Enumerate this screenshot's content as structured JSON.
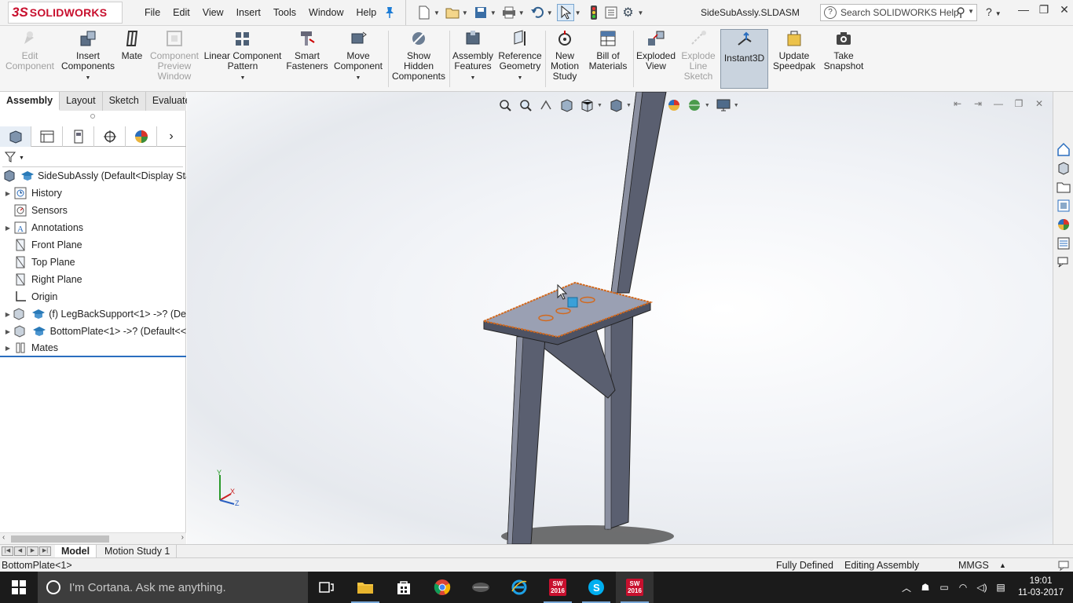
{
  "app": {
    "logo_mark": "3S",
    "logo_text": "SOLIDWORKS",
    "document_title": "SideSubAssly.SLDASM"
  },
  "menu": [
    "File",
    "Edit",
    "View",
    "Insert",
    "Tools",
    "Window",
    "Help"
  ],
  "search": {
    "placeholder": "Search SOLIDWORKS Help"
  },
  "commands": [
    {
      "label": "Edit Component",
      "icon": "edit-component-icon",
      "enabled": false
    },
    {
      "label": "Insert Components",
      "icon": "insert-components-icon",
      "enabled": true
    },
    {
      "label": "Mate",
      "icon": "mate-icon",
      "enabled": true
    },
    {
      "label": "Component Preview Window",
      "icon": "component-preview-icon",
      "enabled": false
    },
    {
      "label": "Linear Component Pattern",
      "icon": "linear-pattern-icon",
      "enabled": true
    },
    {
      "label": "Smart Fasteners",
      "icon": "smart-fasteners-icon",
      "enabled": true
    },
    {
      "label": "Move Component",
      "icon": "move-component-icon",
      "enabled": true
    },
    {
      "label": "Show Hidden Components",
      "icon": "show-hidden-icon",
      "enabled": true
    },
    {
      "label": "Assembly Features",
      "icon": "assembly-features-icon",
      "enabled": true
    },
    {
      "label": "Reference Geometry",
      "icon": "reference-geometry-icon",
      "enabled": true
    },
    {
      "label": "New Motion Study",
      "icon": "motion-study-icon",
      "enabled": true
    },
    {
      "label": "Bill of Materials",
      "icon": "bom-icon",
      "enabled": true
    },
    {
      "label": "Exploded View",
      "icon": "exploded-view-icon",
      "enabled": true
    },
    {
      "label": "Explode Line Sketch",
      "icon": "explode-line-icon",
      "enabled": false
    },
    {
      "label": "Instant3D",
      "icon": "instant3d-icon",
      "enabled": true,
      "active": true
    },
    {
      "label": "Update Speedpak",
      "icon": "speedpak-icon",
      "enabled": true
    },
    {
      "label": "Take Snapshot",
      "icon": "snapshot-icon",
      "enabled": true
    }
  ],
  "tabs": [
    "Assembly",
    "Layout",
    "Sketch",
    "Evaluate"
  ],
  "active_tab": "Assembly",
  "tree": [
    {
      "label": "SideSubAssly  (Default<Display Stat",
      "icon": "assembly-icon",
      "expand": false
    },
    {
      "label": "History",
      "icon": "history-icon",
      "expand": true
    },
    {
      "label": "Sensors",
      "icon": "sensors-icon",
      "expand": false
    },
    {
      "label": "Annotations",
      "icon": "annotations-icon",
      "expand": true
    },
    {
      "label": "Front Plane",
      "icon": "plane-icon",
      "expand": false
    },
    {
      "label": "Top Plane",
      "icon": "plane-icon",
      "expand": false
    },
    {
      "label": "Right Plane",
      "icon": "plane-icon",
      "expand": false
    },
    {
      "label": "Origin",
      "icon": "origin-icon",
      "expand": false
    },
    {
      "label": "(f) LegBackSupport<1> ->? (De",
      "icon": "part-icon",
      "expand": true
    },
    {
      "label": "BottomPlate<1> ->? (Default<<",
      "icon": "part-icon",
      "expand": true
    },
    {
      "label": "Mates",
      "icon": "mates-icon",
      "expand": true
    }
  ],
  "bottom_tabs": [
    "Model",
    "Motion Study 1"
  ],
  "status": {
    "selection": "BottomPlate<1>",
    "definition": "Fully Defined",
    "mode": "Editing Assembly",
    "units": "MMGS"
  },
  "triad": {
    "x": "X",
    "y": "Y",
    "z": "Z"
  },
  "taskbar": {
    "cortana_text": "I'm Cortana. Ask me anything.",
    "time": "19:01",
    "date": "11-03-2017",
    "sw_badge": "SW 2016"
  }
}
